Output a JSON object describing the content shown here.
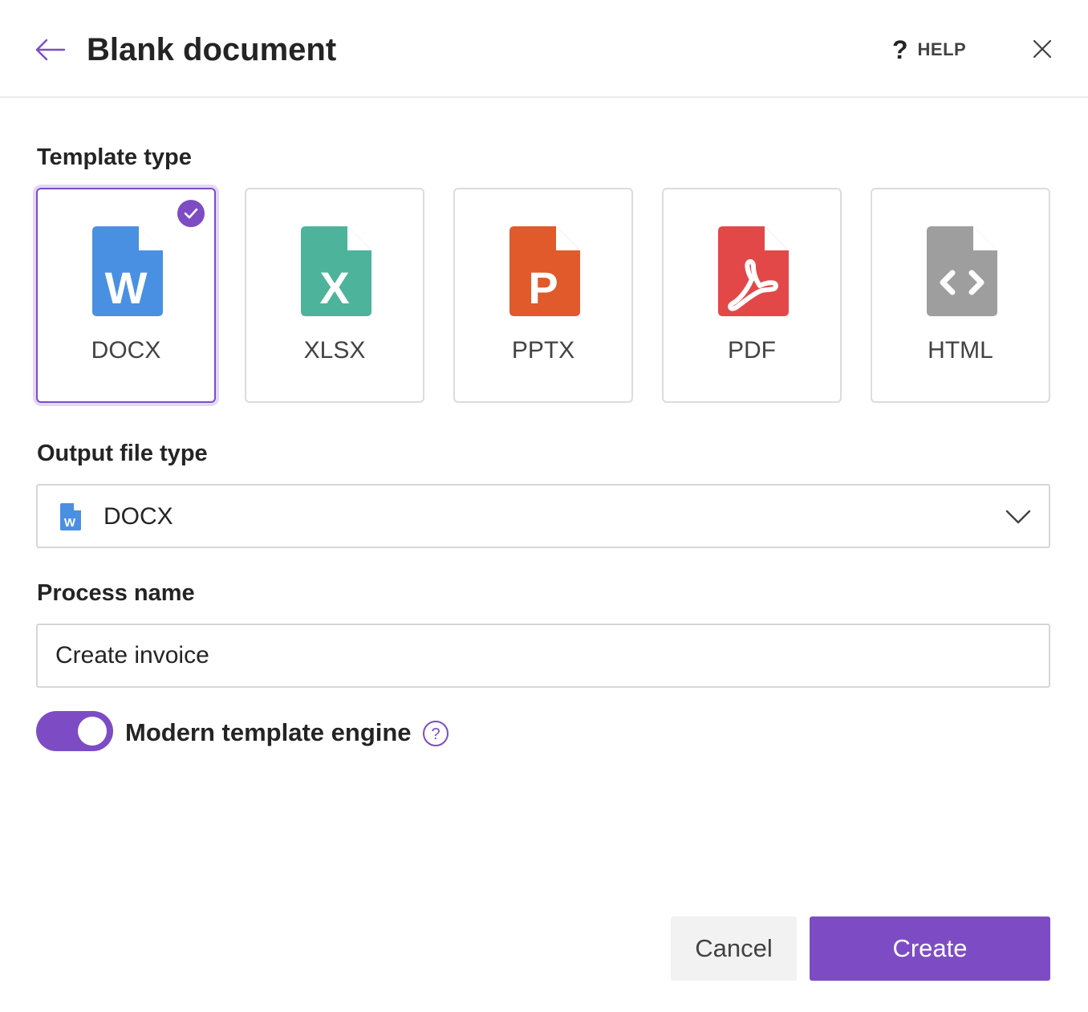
{
  "header": {
    "title": "Blank document",
    "help_label": "HELP",
    "help_glyph": "?",
    "back_icon": "arrow-left-icon",
    "close_icon": "close-icon"
  },
  "template_type": {
    "label": "Template type",
    "selected": "DOCX",
    "options": [
      {
        "label": "DOCX",
        "icon": "word-file-icon",
        "color": "#4a90e2",
        "glyph": "W"
      },
      {
        "label": "XLSX",
        "icon": "excel-file-icon",
        "color": "#4db39a",
        "glyph": "X"
      },
      {
        "label": "PPTX",
        "icon": "powerpoint-file-icon",
        "color": "#e05a2b",
        "glyph": "P"
      },
      {
        "label": "PDF",
        "icon": "pdf-file-icon",
        "color": "#e34848",
        "glyph": ""
      },
      {
        "label": "HTML",
        "icon": "html-file-icon",
        "color": "#9e9e9e",
        "glyph": ""
      }
    ]
  },
  "output_file_type": {
    "label": "Output file type",
    "value": "DOCX",
    "icon": "word-file-icon",
    "icon_glyph": "W"
  },
  "process_name": {
    "label": "Process name",
    "value": "Create invoice"
  },
  "modern_engine": {
    "label": "Modern template engine",
    "enabled": true,
    "info_icon": "help-circle-icon",
    "info_glyph": "?"
  },
  "footer": {
    "cancel_label": "Cancel",
    "create_label": "Create"
  },
  "colors": {
    "accent": "#7d4cc5",
    "text": "#242424",
    "border": "#d6d6d6"
  }
}
